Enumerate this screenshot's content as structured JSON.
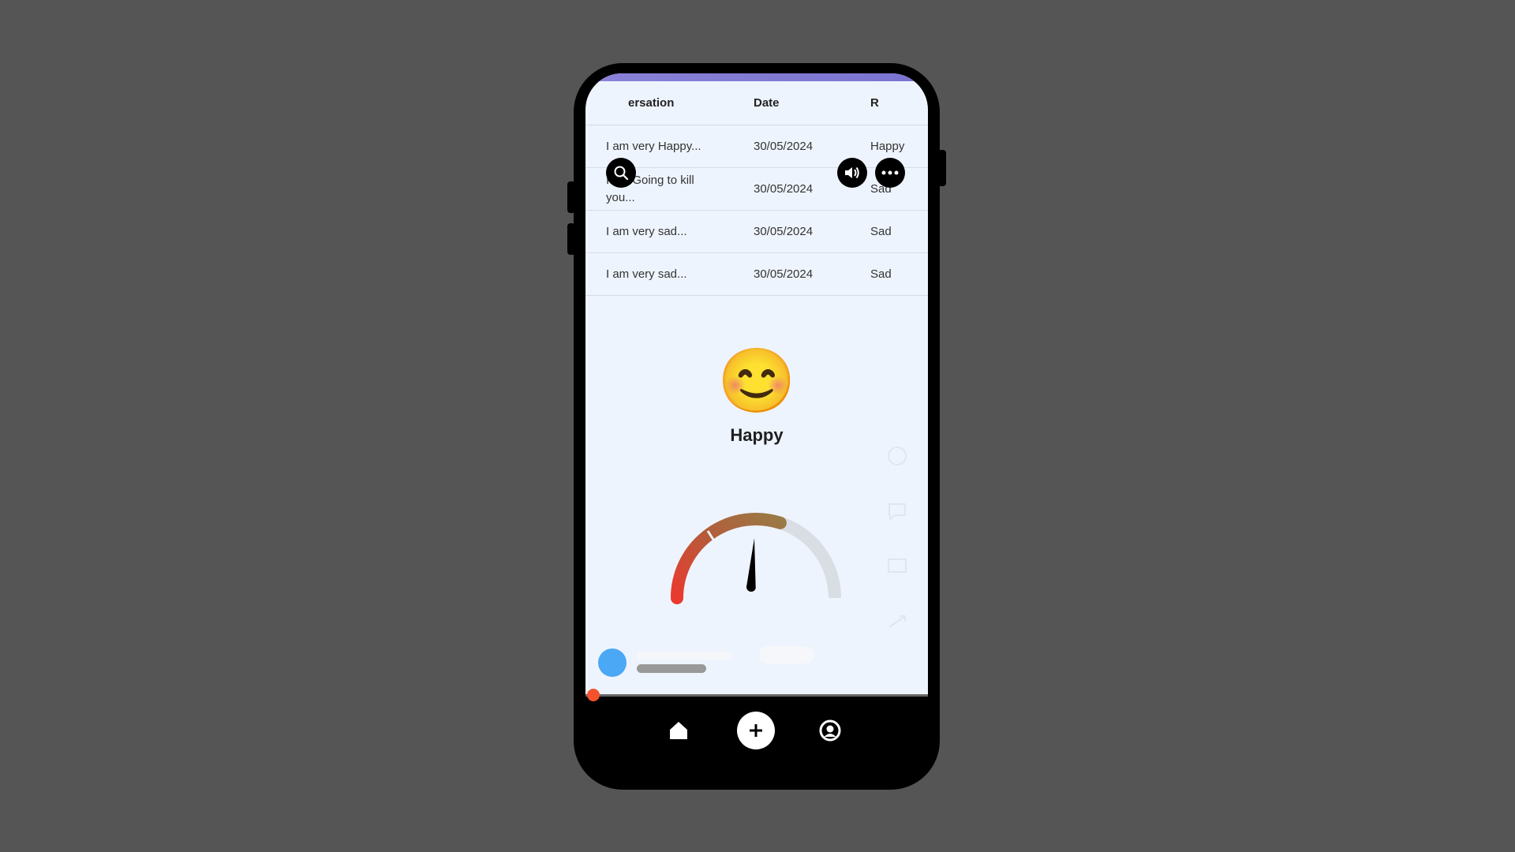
{
  "table": {
    "headers": {
      "conversation": "ersation",
      "date": "Date",
      "result": "R"
    },
    "rows": [
      {
        "conversation": "I am very Happy...",
        "date": "30/05/2024",
        "result": "Happy"
      },
      {
        "conversation": "I am Going to kill you...",
        "date": "30/05/2024",
        "result": "Sad"
      },
      {
        "conversation": "I am very sad...",
        "date": "30/05/2024",
        "result": "Sad"
      },
      {
        "conversation": "I am very sad...",
        "date": "30/05/2024",
        "result": "Sad"
      }
    ]
  },
  "mood": {
    "emoji": "😊",
    "label": "Happy"
  },
  "gauge": {
    "level": 0.6
  },
  "colors": {
    "accent_bar": "#8a82d8",
    "screen_bg": "#eef4fd",
    "progress_dot": "#f4512c",
    "avatar": "#4aa8f5"
  },
  "icons": {
    "top_left": "search-icon",
    "top_right_1": "speaker-icon",
    "top_right_2": "more-icon",
    "nav_left": "home-icon",
    "nav_center": "plus-icon",
    "nav_right": "profile-icon"
  }
}
